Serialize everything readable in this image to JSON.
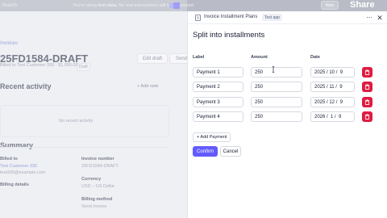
{
  "banner": {
    "search_label": "Search",
    "message_prefix": "You're using ",
    "message_bold": "test data.",
    "message_suffix": " No real transactions will be processed.",
    "now_button": "Now"
  },
  "background": {
    "breadcrumb": "Invoices",
    "invoice_id": "25FD1584-DRAFT",
    "status_badge": "Draft",
    "billed_to": "Billed to Test Customer 330 · $1,000.00",
    "edit_draft": "Edit draft",
    "send": "Send",
    "recent_activity": "Recent activity",
    "add_note": "+ Add note",
    "no_activity": "No recent activity",
    "summary": "Summary",
    "billed_to_label": "Billed to",
    "customer_link": "Test Customer 330",
    "customer_email": "test330@example.com",
    "billing_details": "Billing details",
    "invoice_number_label": "Invoice number",
    "invoice_number": "25FD1584-DRAFT",
    "currency_label": "Currency",
    "currency": "USD – US Dollar",
    "billing_method_label": "Billing method",
    "billing_method": "Send invoice"
  },
  "drawer": {
    "app_name": "Invoice Installment Plans",
    "app_badge": "Test app",
    "more_glyph": "⋯",
    "close_glyph": "✕",
    "title": "Split into installments",
    "columns": {
      "label": "Label",
      "amount": "Amount",
      "date": "Date"
    },
    "rows": [
      {
        "label": "Payment 1",
        "amount": "250",
        "date": "2025 / 10 /  9"
      },
      {
        "label": "Payment 2",
        "amount": "250",
        "date": "2025 / 11 /  9"
      },
      {
        "label": "Payment 3",
        "amount": "250",
        "date": "2025 / 12 /  9"
      },
      {
        "label": "Payment 4",
        "amount": "250",
        "date": "2026 /  1 /  9"
      }
    ],
    "add_payment": "+ Add Payment",
    "confirm": "Confirm",
    "cancel": "Cancel"
  },
  "watermark": "Share",
  "colors": {
    "accent": "#635bff",
    "danger": "#df1b41",
    "banner": "#b9bcc6"
  }
}
